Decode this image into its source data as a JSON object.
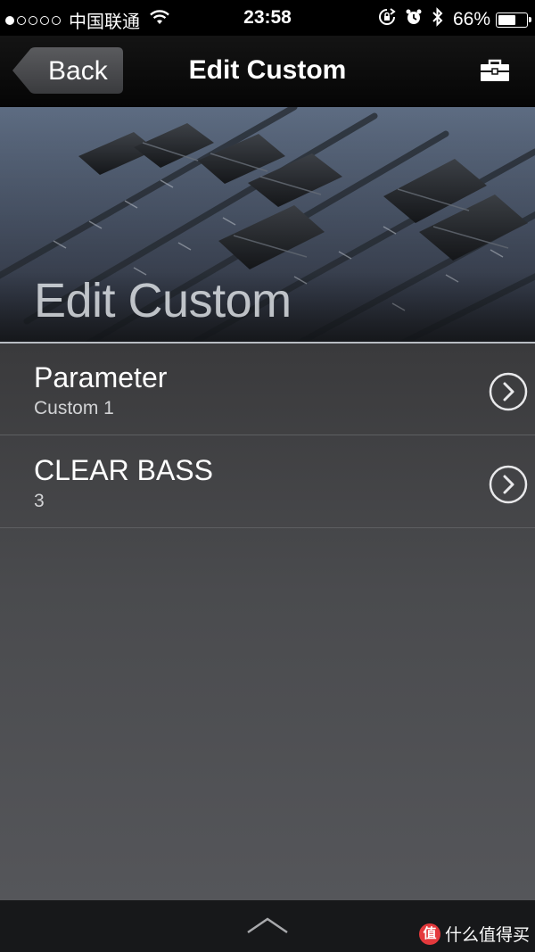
{
  "status_bar": {
    "carrier": "中国联通",
    "time": "23:58",
    "battery_percent": "66%",
    "battery_level": 0.66,
    "signal_bars_filled": 1,
    "signal_bars_total": 5,
    "icons": [
      "wifi-icon",
      "rotation-lock-icon",
      "alarm-icon",
      "bluetooth-icon",
      "battery-icon"
    ]
  },
  "nav": {
    "back_label": "Back",
    "title": "Edit Custom",
    "right_icon": "toolbox-icon"
  },
  "hero": {
    "title": "Edit Custom",
    "image": "mixing-console-faders"
  },
  "settings": [
    {
      "title": "Parameter",
      "value": "Custom 1"
    },
    {
      "title": "CLEAR BASS",
      "value": "3"
    }
  ],
  "bottom_bar": {
    "icon": "chevron-up-icon",
    "watermark": "什么值得买",
    "watermark_logo": "值"
  },
  "colors": {
    "bar_background": "#000000",
    "list_background": "#45464a",
    "divider": "#b8bcc2"
  }
}
